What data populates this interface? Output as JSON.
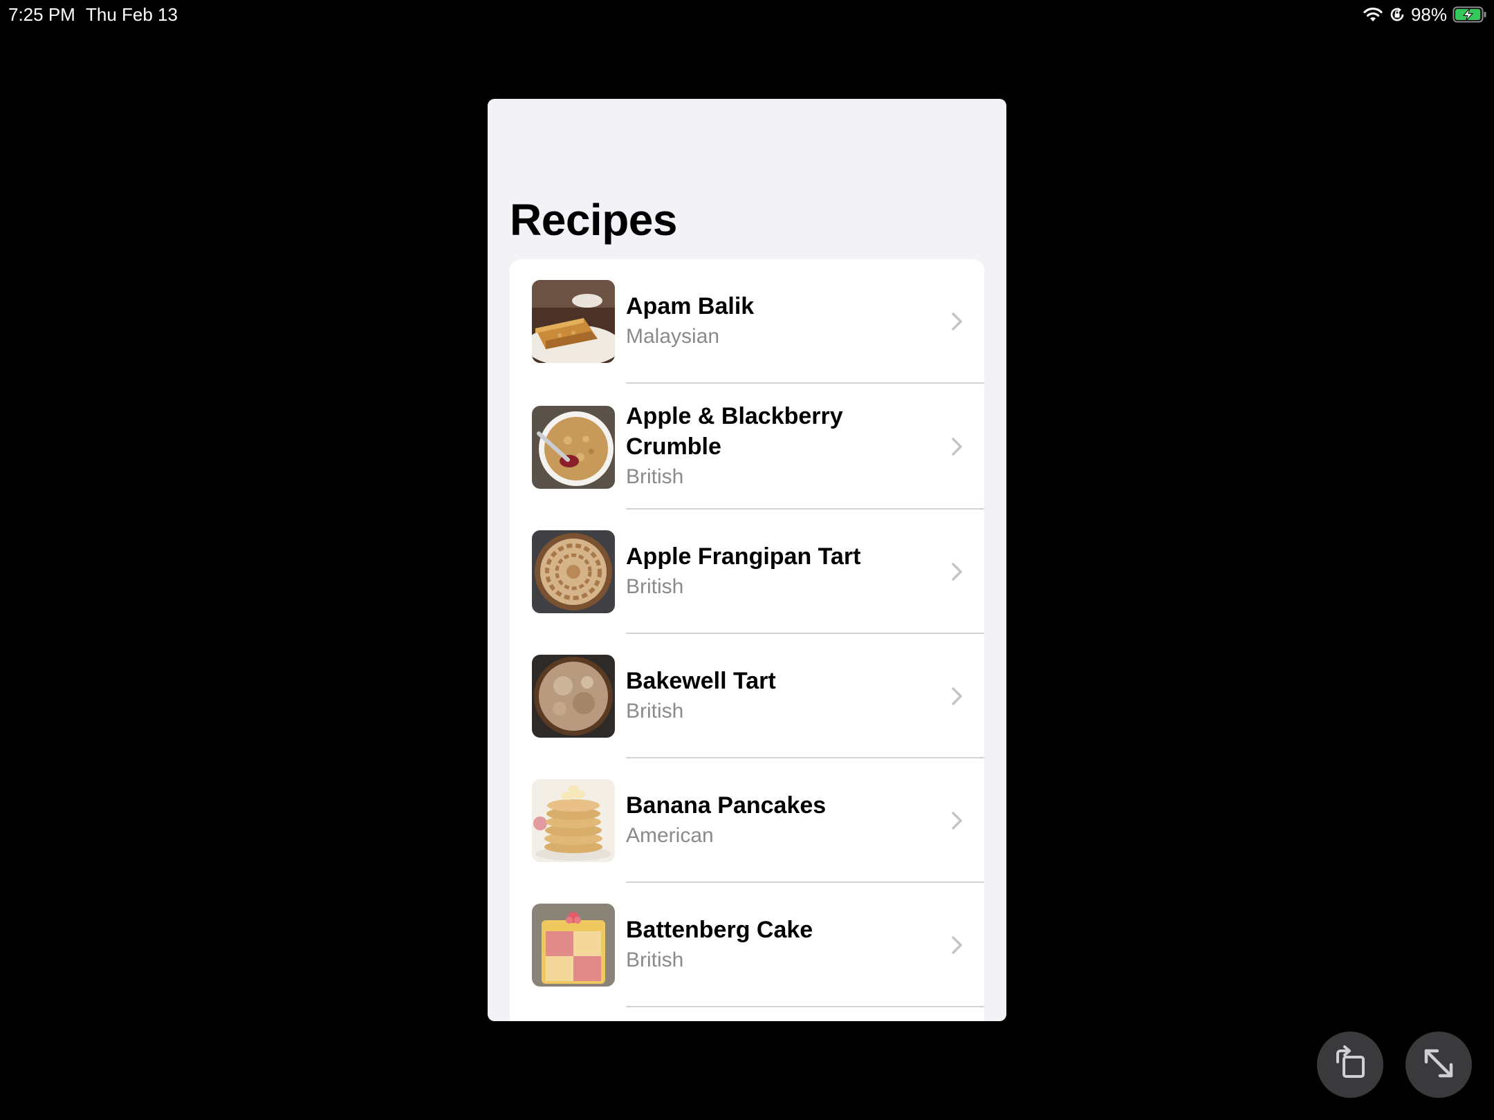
{
  "status_bar": {
    "time": "7:25 PM",
    "date": "Thu Feb 13",
    "battery_percent": "98%",
    "battery_level": 0.98,
    "battery_color": "#34c759",
    "icons": [
      "wifi-icon",
      "orientation-lock-icon",
      "battery-charging-icon"
    ]
  },
  "app": {
    "title": "Recipes",
    "recipes": [
      {
        "name": "Apam Balik",
        "area": "Malaysian",
        "thumbnail_icon": "apam-balik-thumbnail"
      },
      {
        "name": "Apple & Blackberry Crumble",
        "area": "British",
        "thumbnail_icon": "apple-blackberry-crumble-thumbnail"
      },
      {
        "name": "Apple Frangipan Tart",
        "area": "British",
        "thumbnail_icon": "apple-frangipan-tart-thumbnail"
      },
      {
        "name": "Bakewell Tart",
        "area": "British",
        "thumbnail_icon": "bakewell-tart-thumbnail"
      },
      {
        "name": "Banana Pancakes",
        "area": "American",
        "thumbnail_icon": "banana-pancakes-thumbnail"
      },
      {
        "name": "Battenberg Cake",
        "area": "British",
        "thumbnail_icon": "battenberg-cake-thumbnail"
      }
    ],
    "row_icon": "chevron-right-icon"
  },
  "controls": {
    "rotate_icon": "rotate-icon",
    "expand_icon": "expand-icon"
  },
  "colors": {
    "background": "#000000",
    "window_background": "#f2f2f7",
    "card_background": "#ffffff",
    "secondary_text": "#8a8a8e",
    "separator": "#d4d4d8",
    "chevron": "#c4c4c7",
    "button_background": "#3a3a3c"
  }
}
